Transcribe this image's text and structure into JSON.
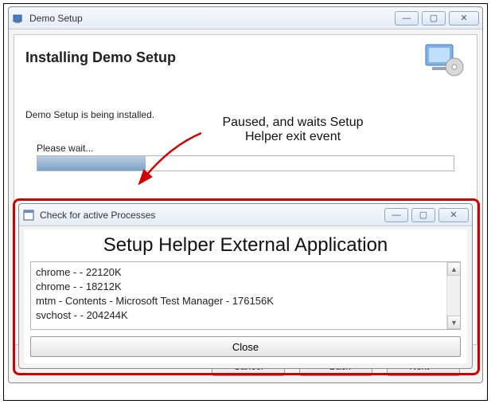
{
  "main_window": {
    "title": "Demo Setup",
    "heading": "Installing Demo Setup",
    "status_text": "Demo Setup is being installed.",
    "please_wait": "Please wait...",
    "progress_percent": 26,
    "buttons": {
      "cancel": "Cancel",
      "back": "< Back",
      "next": "Next >"
    }
  },
  "annotation": {
    "line1": "Paused, and waits Setup",
    "line2": "Helper exit event"
  },
  "sub_window": {
    "title": "Check for active Processes",
    "heading": "Setup Helper External Application",
    "processes": [
      "chrome -  - 22120K",
      "chrome -  - 18212K",
      "mtm - Contents - Microsoft Test Manager - 176156K",
      "svchost -  - 204244K"
    ],
    "close_label": "Close"
  },
  "window_controls": {
    "minimize": "—",
    "maximize": "▢",
    "close": "✕"
  },
  "colors": {
    "highlight_red": "#d00000",
    "progress_blue": "#7fa2c6"
  }
}
